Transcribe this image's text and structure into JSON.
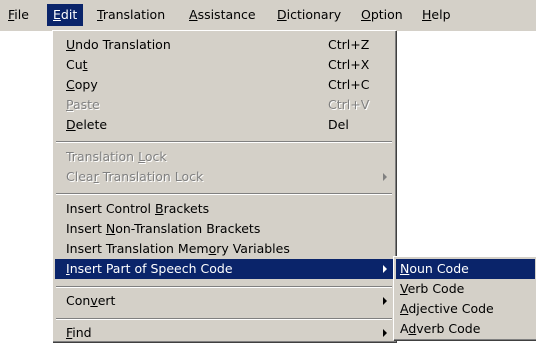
{
  "menubar": {
    "items": [
      {
        "pre": "",
        "key": "F",
        "post": "ile"
      },
      {
        "pre": "",
        "key": "E",
        "post": "dit"
      },
      {
        "pre": "",
        "key": "T",
        "post": "ranslation"
      },
      {
        "pre": "",
        "key": "A",
        "post": "ssistance"
      },
      {
        "pre": "",
        "key": "D",
        "post": "ictionary"
      },
      {
        "pre": "",
        "key": "O",
        "post": "ption"
      },
      {
        "pre": "",
        "key": "H",
        "post": "elp"
      }
    ]
  },
  "edit_menu": {
    "items": [
      {
        "pre": "",
        "key": "U",
        "post": "ndo Translation",
        "accel": "Ctrl+Z"
      },
      {
        "pre": "Cu",
        "key": "t",
        "post": "",
        "accel": "Ctrl+X"
      },
      {
        "pre": "",
        "key": "C",
        "post": "opy",
        "accel": "Ctrl+C"
      },
      {
        "pre": "",
        "key": "P",
        "post": "aste",
        "accel": "Ctrl+V"
      },
      {
        "pre": "",
        "key": "D",
        "post": "elete",
        "accel": "Del"
      },
      {
        "pre": "Translation ",
        "key": "L",
        "post": "ock"
      },
      {
        "pre": "Clea",
        "key": "r",
        "post": " Translation Lock"
      },
      {
        "pre": "Insert Control ",
        "key": "B",
        "post": "rackets"
      },
      {
        "pre": "Insert ",
        "key": "N",
        "post": "on-Translation Brackets"
      },
      {
        "pre": "Insert Translation Mem",
        "key": "o",
        "post": "ry Variables"
      },
      {
        "pre": "",
        "key": "I",
        "post": "nsert Part of Speech Code"
      },
      {
        "pre": "Con",
        "key": "v",
        "post": "ert"
      },
      {
        "pre": "",
        "key": "F",
        "post": "ind"
      }
    ]
  },
  "submenu": {
    "items": [
      {
        "pre": "",
        "key": "N",
        "post": "oun Code"
      },
      {
        "pre": "",
        "key": "V",
        "post": "erb Code"
      },
      {
        "pre": "",
        "key": "A",
        "post": "djective Code"
      },
      {
        "pre": "A",
        "key": "d",
        "post": "verb Code"
      }
    ]
  }
}
